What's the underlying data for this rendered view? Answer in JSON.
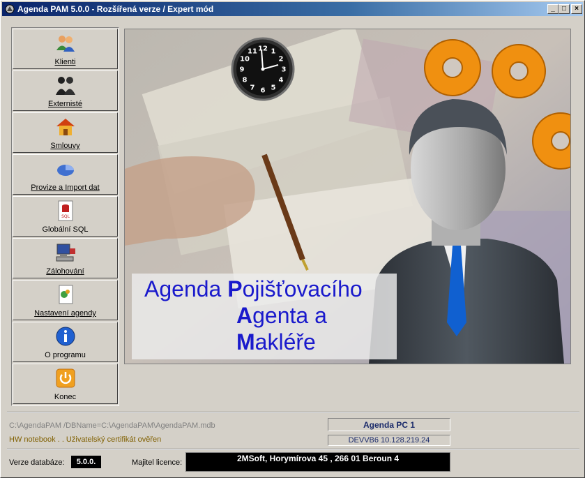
{
  "window": {
    "title": "Agenda PAM 5.0.0 - Rozšířená verze / Expert mód"
  },
  "sidebar": {
    "items": [
      {
        "label": "Klienti",
        "icon": "clients-icon"
      },
      {
        "label": "Externisté",
        "icon": "externists-icon"
      },
      {
        "label": "Smlouvy",
        "icon": "house-icon"
      },
      {
        "label": "Provize a Import dat",
        "icon": "pie-chart-icon"
      },
      {
        "label": "Globální SQL",
        "icon": "sql-database-icon"
      },
      {
        "label": "Zálohování",
        "icon": "backup-computer-icon"
      },
      {
        "label": "Nastavení agendy",
        "icon": "settings-document-icon"
      },
      {
        "label": "O programu",
        "icon": "info-icon"
      },
      {
        "label": "Konec",
        "icon": "power-icon"
      }
    ]
  },
  "hero": {
    "line1_prefix": "Agenda ",
    "line1_initial": "P",
    "line1_rest": "ojišťovacího",
    "line2_initial": "A",
    "line2_rest": "genta a",
    "line3_initial": "M",
    "line3_rest": "akléře",
    "clock_numbers": [
      "12",
      "1",
      "2",
      "3",
      "4",
      "5",
      "6",
      "7",
      "8",
      "9",
      "10",
      "11"
    ]
  },
  "status": {
    "path": "C:\\AgendaPAM  /DBName=C:\\AgendaPAM\\AgendaPAM.mdb",
    "hw": "HW notebook . . Uživatelský certifikát ověřen",
    "pc_name": "Agenda PC 1",
    "pc_info": "DEVVB6  10.128.219.24",
    "db_version_label": "Verze databáze:",
    "db_version": "5.0.0.",
    "owner_label": "Majitel licence:",
    "owner": "2MSoft, Horymírova 45 , 266 01  Beroun 4"
  },
  "colors": {
    "title_blue": "#1a1acc",
    "titlebar": "#0a246a"
  }
}
